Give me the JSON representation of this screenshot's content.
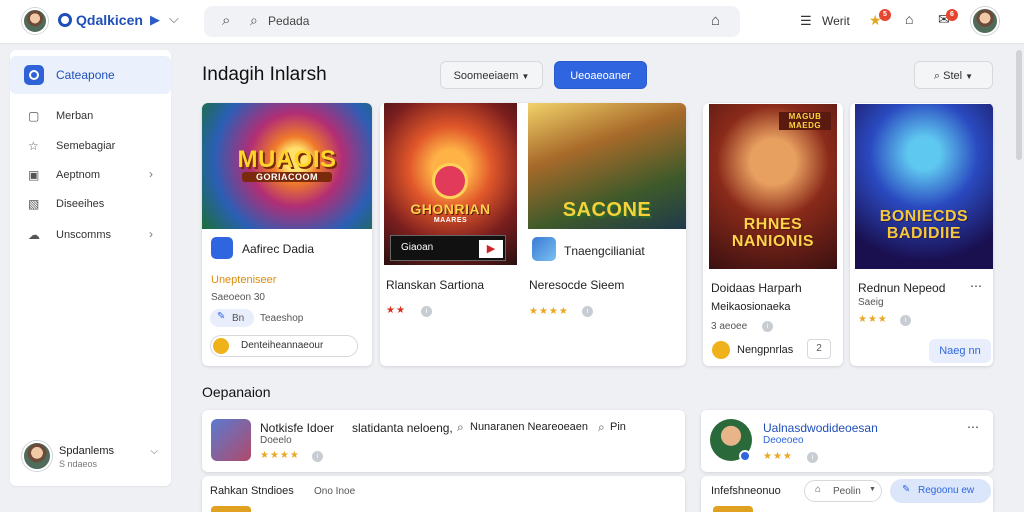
{
  "app": {
    "title": "Qdalkicen"
  },
  "search": {
    "placeholder": "Pedada"
  },
  "header": {
    "menu_label": "Werit"
  },
  "badges": {
    "notif_a": "5",
    "notif_b": "6"
  },
  "sidebar": {
    "active": "Cateapone",
    "items": [
      {
        "label": "Merban"
      },
      {
        "label": "Semebagiar"
      },
      {
        "label": "Aeptnom"
      },
      {
        "label": "Diseeihes"
      },
      {
        "label": "Unscomms"
      }
    ],
    "user": {
      "name": "Spdanlems",
      "sub": "S ndaeos"
    }
  },
  "main": {
    "title": "Indagih Inlarsh",
    "sort_label": "Soomeeiaem",
    "primary_label": "Ueoaeoaner",
    "filter_label": "Stel"
  },
  "cards": [
    {
      "thumb_text": "MUAOIS",
      "thumb_sub": "GORIACOOM",
      "title": "Aafirec Dadia",
      "highlight": "Unepteniseer",
      "meta": "Saeoeon  30",
      "chip_label": "Bn",
      "chip_text": "Teaeshop",
      "action": "Denteiheannaeour"
    },
    {
      "thumb_text": "GHONRIAN",
      "thumb_sub": "MAARES",
      "banner": "Giaoan",
      "title": "Rlanskan Sartiona",
      "stars": "★★"
    },
    {
      "thumb_text": "SACONE",
      "title": "Tnaengcilianiat",
      "subtitle": "Neresocde Sieem",
      "stars": "★★★★"
    },
    {
      "thumb_text": "RHNES NANIONIS",
      "thumb_top": "MAGUB MAEDG",
      "title": "Doidaas Harparh",
      "subtitle": "Meikaosionaeka",
      "meta": "3 aeoee",
      "action": "Nengpnrlas",
      "action_count": "2"
    },
    {
      "thumb_text": "BONIECDS BADIDIIE",
      "title": "Rednun Nepeod",
      "subtitle": "Saeig",
      "stars": "★★★",
      "button": "Naeg nn"
    }
  ],
  "companion": {
    "title": "Oepanaion",
    "rows": [
      {
        "title": "Notkisfe Idoer",
        "detail": "slatidanta neloeng,",
        "extra": "Nunaranen Neareoeaen",
        "pin": "Pin",
        "sub": "Doeelo",
        "stars": "★★★★"
      },
      {
        "title": "Ualnasdwodideoesan",
        "sub": "Deoeoeo",
        "stars": "★★★"
      }
    ],
    "bottom": [
      {
        "title": "Rahkan Stndioes",
        "tag": "Ono Inoe"
      },
      {
        "title": "Infefshneonuo",
        "select": "Peolin",
        "button": "Regoonu ew"
      }
    ]
  },
  "colors": {
    "accent": "#2f66e0",
    "brand": "#1f4fb8",
    "star": "#e9a825"
  }
}
